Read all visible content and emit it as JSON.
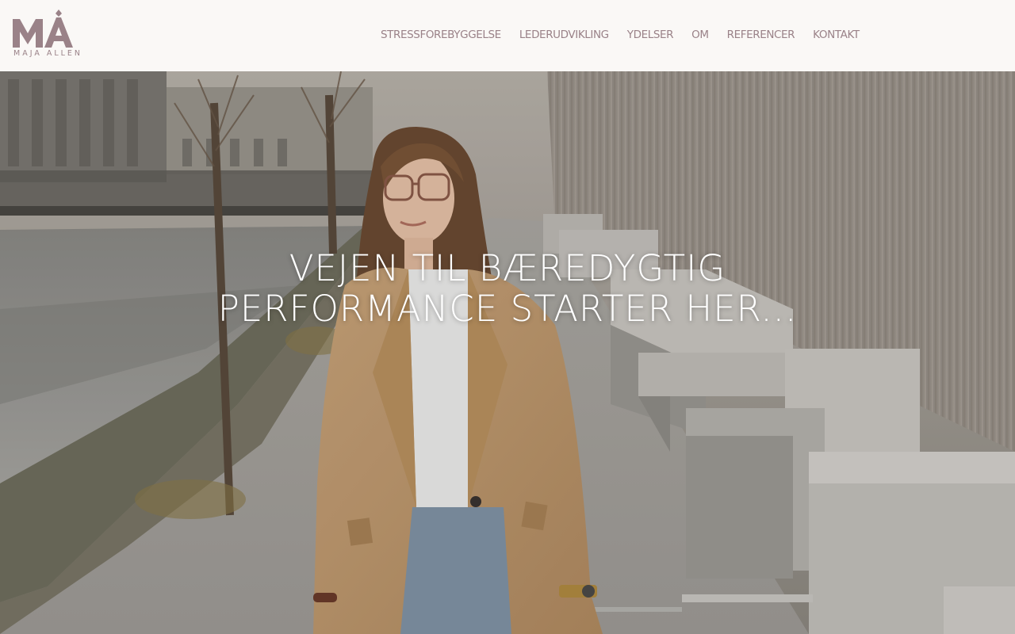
{
  "brand": {
    "logo_letters": "MÅ",
    "logo_name": "MAJA ALLEN",
    "logo_color": "#9a8288"
  },
  "nav": {
    "items": [
      {
        "label": "STRESSFOREBYGGELSE"
      },
      {
        "label": "LEDERUDVIKLING"
      },
      {
        "label": "YDELSER"
      },
      {
        "label": "OM"
      },
      {
        "label": "REFERENCER"
      },
      {
        "label": "KONTAKT"
      }
    ],
    "text_color": "#9a8288"
  },
  "hero": {
    "title_line1": "VEJEN TIL BÆREDYGTIG",
    "title_line2": "PERFORMANCE STARTER HER..."
  }
}
